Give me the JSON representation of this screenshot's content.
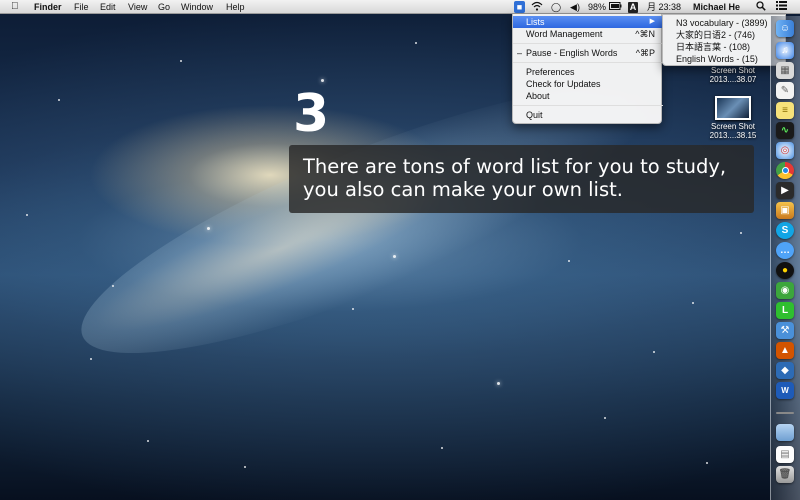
{
  "menubar": {
    "apple": "",
    "app_name": "Finder",
    "menus": [
      "File",
      "Edit",
      "View",
      "Go",
      "Window",
      "Help"
    ],
    "battery": "98%",
    "input_source": "A",
    "clock": "月 23:38",
    "user": "Michael He"
  },
  "menu": {
    "lists": "Lists",
    "word_management": "Word Management",
    "word_management_shortcut": "^⌘N",
    "pause": "Pause - English Words",
    "pause_shortcut": "^⌘P",
    "pause_mark": "–",
    "preferences": "Preferences",
    "check_updates": "Check for Updates",
    "about": "About",
    "quit": "Quit"
  },
  "submenu": [
    "N3 vocabulary - (3899)",
    "大家的日语2 - (746)",
    "日本語言葉 - (108)",
    "English Words - (15)"
  ],
  "desktop": {
    "items": [
      {
        "name": "Screen Shot",
        "date": "2013....38.07"
      },
      {
        "name": "Screen Shot",
        "date": "2013....38.15"
      }
    ]
  },
  "overlay": {
    "step": "3",
    "line1": "There are tons of word list for you to study,",
    "line2": "you also can make your own list."
  },
  "dock_icons": [
    "finder",
    "itunes",
    "preview",
    "textedit",
    "notes",
    "activity-monitor",
    "safari",
    "chrome",
    "facetime",
    "photo-booth",
    "skype-s",
    "messages",
    "qq",
    "wechat",
    "line",
    "xcode",
    "keynote",
    "virtualbox",
    "word-app",
    "folder",
    "document",
    "trash"
  ]
}
